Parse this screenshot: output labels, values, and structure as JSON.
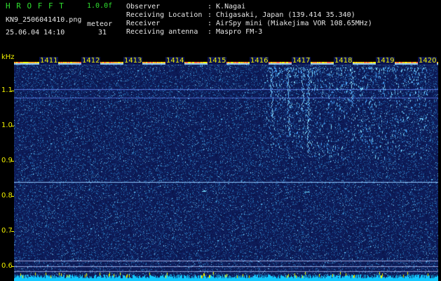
{
  "header": {
    "brand": "H R O F F T",
    "version": "1.0.0f",
    "filename": "KN9_2506041410.png",
    "mode_label": "meteor",
    "datetime": "25.06.04 14:10",
    "count": "31",
    "fields": [
      {
        "key": "Observer",
        "value": ": K.Nagai"
      },
      {
        "key": "Receiving Location",
        "value": ": Chigasaki, Japan (139.414 35.340)"
      },
      {
        "key": "Receiver",
        "value": ": AirSpy mini (Miakejima VOR 108.65MHz)"
      },
      {
        "key": "Receiving antenna",
        "value": ": Maspro FM-3"
      }
    ]
  },
  "waterfall": {
    "y_unit": "kHz",
    "y_labels": [
      "1.1",
      "1.0",
      "0.9",
      "0.8",
      "0.7",
      "0.6"
    ],
    "minute_labels": [
      "1411",
      "1412",
      "1413",
      "1414",
      "1415",
      "1416",
      "1417",
      "1418",
      "1419",
      "1420"
    ],
    "colors": {
      "background": "#09124e",
      "label": "#f0f000",
      "signal": "#6fd8ff"
    }
  }
}
